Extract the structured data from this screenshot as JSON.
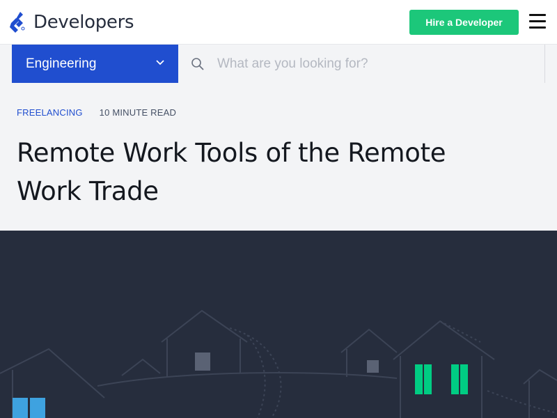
{
  "brand": {
    "name": "Developers",
    "logo_icon": "toptal-logo-icon"
  },
  "header": {
    "hire_button": "Hire a Developer",
    "menu_icon": "hamburger-menu-icon"
  },
  "filter": {
    "category": "Engineering",
    "search_placeholder": "What are you looking for?",
    "search_value": ""
  },
  "article": {
    "category": "FREELANCING",
    "read_time": "10 MINUTE READ",
    "title_line1": "Remote Work Tools of the Remote",
    "title_line2": "Work Trade"
  },
  "hero": {
    "illustration": "houses-at-night"
  },
  "colors": {
    "accent_blue": "#204ecf",
    "cta_green": "#1cc77a",
    "hero_bg": "#262d3d",
    "window_green": "#00cc83",
    "window_blue": "#3ea2e0"
  }
}
